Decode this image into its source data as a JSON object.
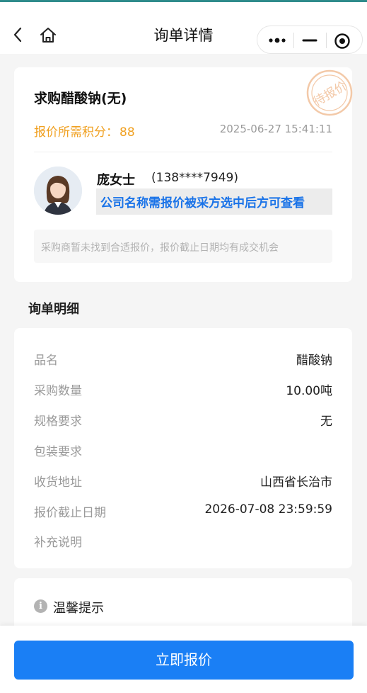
{
  "nav": {
    "title": "询单详情",
    "icons": [
      "back-arrow-icon",
      "home-icon",
      "more-dots-icon",
      "minimize-icon",
      "close-target-icon"
    ]
  },
  "request": {
    "title": "求购醋酸钠(无)",
    "points_label": "报价所需积分：",
    "points_value": "88",
    "time": "2025-06-27 15:41:11",
    "stamp_text": "待报价",
    "stamp_color": "#f3c9a8"
  },
  "contact": {
    "name": "庞女士",
    "phone": "(138****7949)",
    "company_note": "公司名称需报价被采方选中后方可查看",
    "hint": "采购商暂未找到合适报价，报价截止日期均有成交机会"
  },
  "detail": {
    "section_title": "询单明细",
    "rows": [
      {
        "label": "品名",
        "value": "醋酸钠"
      },
      {
        "label": "采购数量",
        "value": "10.00吨"
      },
      {
        "label": "规格要求",
        "value": "无"
      },
      {
        "label": "包装要求",
        "value": ""
      },
      {
        "label": "收货地址",
        "value": "山西省长治市"
      },
      {
        "label": "报价截止日期",
        "value": "2026-07-08 23:59:59"
      },
      {
        "label": "补充说明",
        "value": ""
      }
    ]
  },
  "tips": {
    "title": "温馨提示"
  },
  "actions": {
    "quote_label": "立即报价"
  },
  "colors": {
    "accent": "#1a7ff5",
    "points": "#f0a020",
    "company_note": "#1a73e8"
  }
}
